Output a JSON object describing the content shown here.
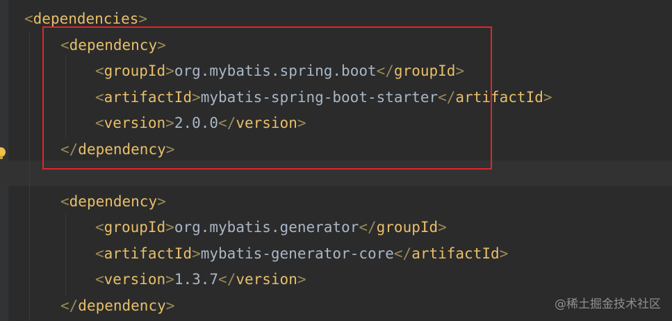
{
  "editor": {
    "lines": [
      {
        "indent": 0,
        "kind": "open",
        "tag": "dependencies",
        "value": ""
      },
      {
        "indent": 1,
        "kind": "open",
        "tag": "dependency",
        "value": ""
      },
      {
        "indent": 2,
        "kind": "pair",
        "tag": "groupId",
        "value": "org.mybatis.spring.boot"
      },
      {
        "indent": 2,
        "kind": "pair",
        "tag": "artifactId",
        "value": "mybatis-spring-boot-starter"
      },
      {
        "indent": 2,
        "kind": "pair",
        "tag": "version",
        "value": "2.0.0"
      },
      {
        "indent": 1,
        "kind": "close",
        "tag": "dependency",
        "value": ""
      },
      {
        "indent": 0,
        "kind": "blank",
        "tag": "",
        "value": ""
      },
      {
        "indent": 1,
        "kind": "open",
        "tag": "dependency",
        "value": ""
      },
      {
        "indent": 2,
        "kind": "pair",
        "tag": "groupId",
        "value": "org.mybatis.generator"
      },
      {
        "indent": 2,
        "kind": "pair",
        "tag": "artifactId",
        "value": "mybatis-generator-core"
      },
      {
        "indent": 2,
        "kind": "pair",
        "tag": "version",
        "value": "1.3.7"
      },
      {
        "indent": 1,
        "kind": "close",
        "tag": "dependency",
        "value": ""
      }
    ]
  },
  "watermark": {
    "text": "@稀土掘金技术社区"
  },
  "colors": {
    "background": "#2b2b2b",
    "tag": "#e8bf6a",
    "text": "#a9b7c6",
    "highlight_box": "#e0262d"
  }
}
